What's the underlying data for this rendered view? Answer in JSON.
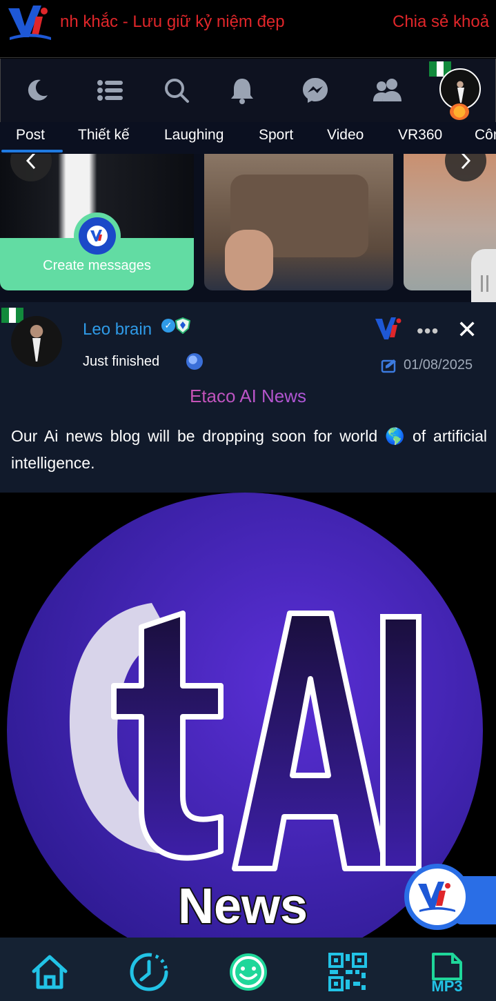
{
  "banner": {
    "marquee_text_1": "nh khắc - Lưu giữ kỷ niệm đẹp",
    "marquee_text_2": "Chia sẻ khoả"
  },
  "toolbar": {
    "icons": [
      "moon-icon",
      "list-icon",
      "search-icon",
      "bell-icon",
      "messenger-icon",
      "friends-icon"
    ]
  },
  "tabs": [
    "Post",
    "Thiết kế",
    "Laughing",
    "Sport",
    "Video",
    "VR360",
    "Côn"
  ],
  "stories": {
    "create_label": "Create messages"
  },
  "post": {
    "username": "Leo brain",
    "status": "Just finished",
    "date": "01/08/2025",
    "title": "Etaco AI News",
    "body": "Our Ai news blog will be dropping soon for world 🌎 of artificial intelligence."
  },
  "image": {
    "logo_letters": "tAI",
    "logo_word": "News"
  },
  "bottom_nav": {
    "items": [
      "home-icon",
      "history-icon",
      "smile-icon",
      "qr-code-icon",
      "mp3-icon"
    ],
    "mp3_label": "MP3"
  },
  "colors": {
    "accent_blue": "#2f9be8",
    "banner_red": "#e0262a",
    "create_green": "#62dca3",
    "nav_cyan": "#22c3e6",
    "nav_green": "#1fd79a"
  }
}
